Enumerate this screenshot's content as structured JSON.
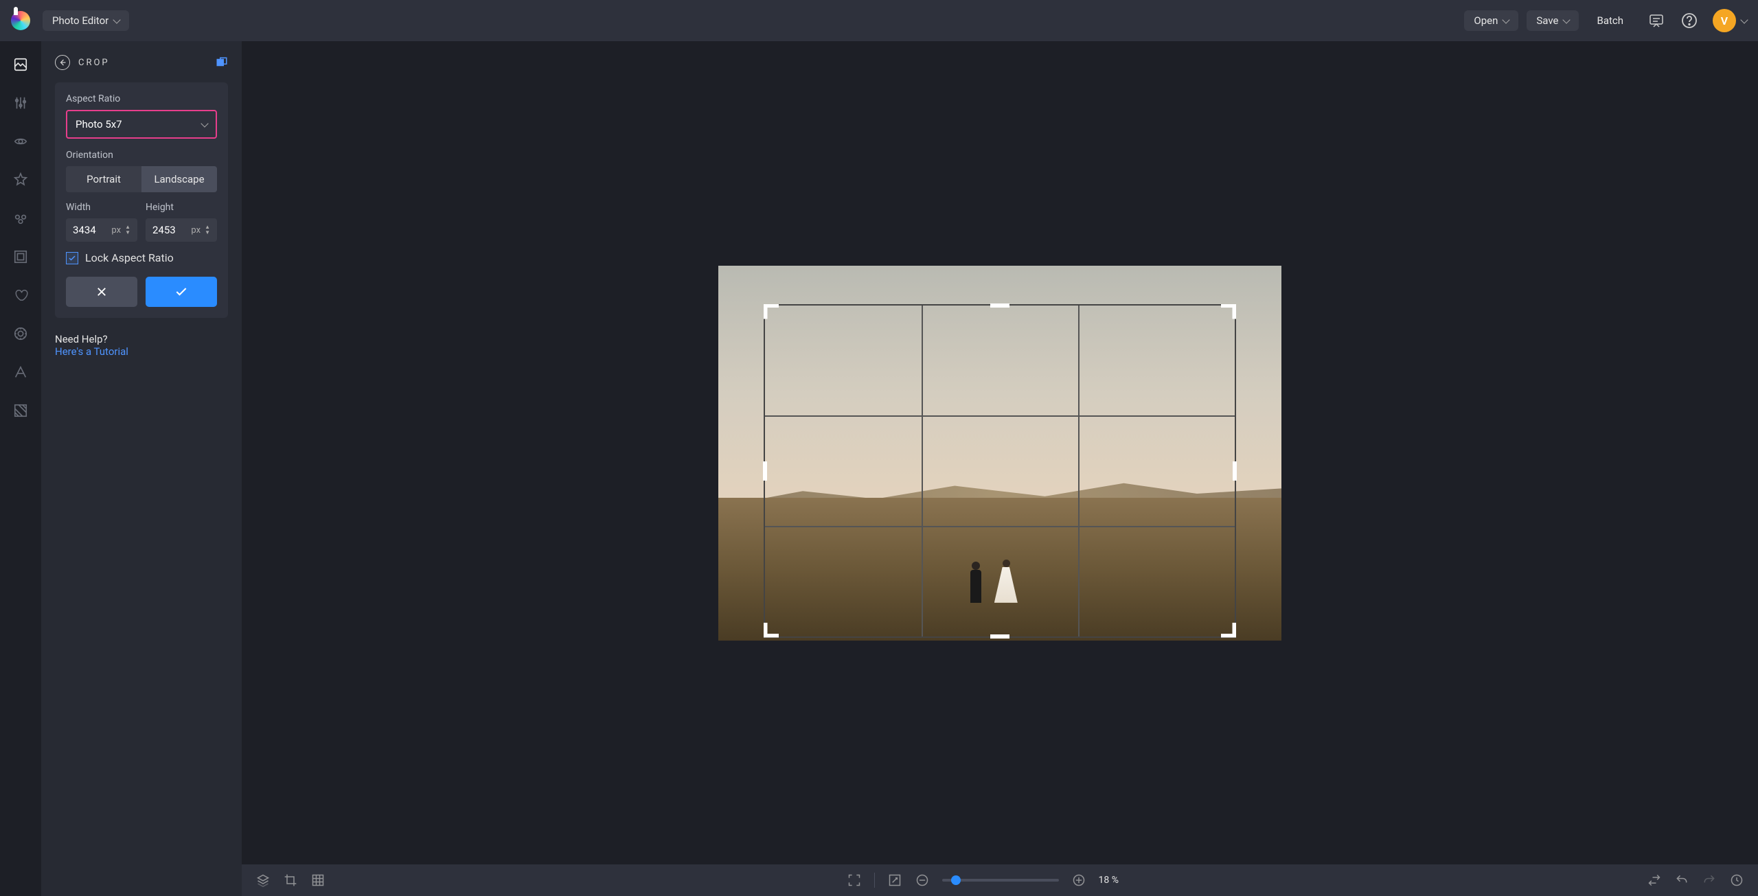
{
  "header": {
    "mode_label": "Photo Editor",
    "open_label": "Open",
    "save_label": "Save",
    "batch_label": "Batch",
    "avatar_initial": "V"
  },
  "panel": {
    "title": "CROP",
    "aspect_ratio_label": "Aspect Ratio",
    "aspect_ratio_value": "Photo 5x7",
    "orientation_label": "Orientation",
    "orientation_options": {
      "portrait": "Portrait",
      "landscape": "Landscape"
    },
    "orientation_selected": "landscape",
    "width_label": "Width",
    "height_label": "Height",
    "width_value": "3434",
    "height_value": "2453",
    "unit": "px",
    "lock_label": "Lock Aspect Ratio",
    "lock_checked": true
  },
  "help": {
    "question": "Need Help?",
    "link": "Here's a Tutorial"
  },
  "bottombar": {
    "zoom_percent": "18 %"
  },
  "colors": {
    "highlight": "#e83e8c",
    "primary": "#2a8cff"
  }
}
